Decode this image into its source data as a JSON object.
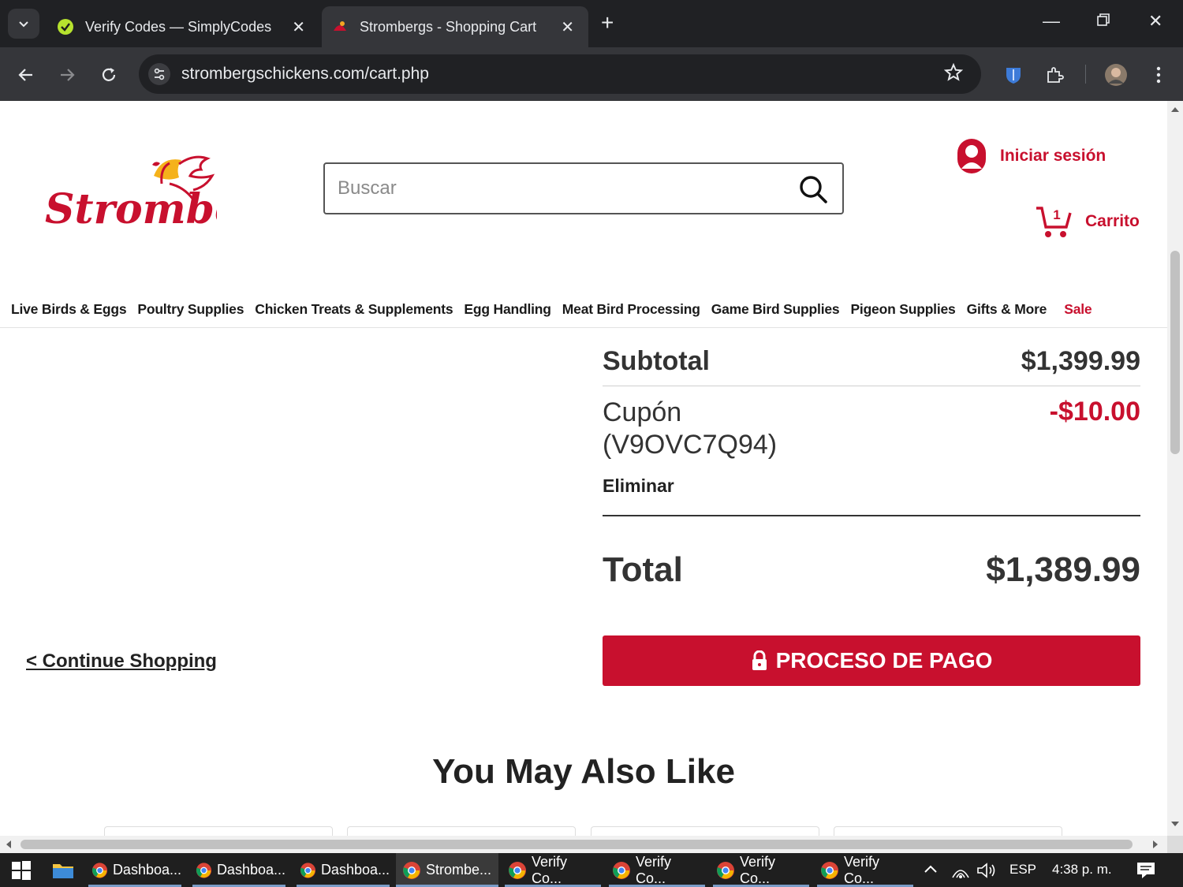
{
  "browser": {
    "tabs": [
      {
        "title": "Verify Codes — SimplyCodes"
      },
      {
        "title": "Strombergs - Shopping Cart"
      }
    ],
    "url": "strombergschickens.com/cart.php"
  },
  "header": {
    "logo_text": "Strombergs",
    "search_placeholder": "Buscar",
    "login_label": "Iniciar sesión",
    "cart_label": "Carrito",
    "cart_count": "1"
  },
  "nav": {
    "items": [
      "Live Birds & Eggs",
      "Poultry Supplies",
      "Chicken Treats & Supplements",
      "Egg Handling",
      "Meat Bird Processing",
      "Game Bird Supplies",
      "Pigeon Supplies",
      "Gifts & More"
    ],
    "sale": "Sale"
  },
  "summary": {
    "subtotal_label": "Subtotal",
    "subtotal_value": "$1,399.99",
    "coupon_label": "Cupón (V9OVC7Q94)",
    "coupon_value": "-$10.00",
    "coupon_remove": "Eliminar",
    "total_label": "Total",
    "total_value": "$1,389.99"
  },
  "actions": {
    "continue_shopping": "< Continue Shopping",
    "checkout": "PROCESO DE PAGO"
  },
  "recommend": {
    "title": "You May Also Like"
  },
  "taskbar": {
    "items": [
      "Dashboa...",
      "Dashboa...",
      "Dashboa...",
      "Strombe...",
      "Verify Co...",
      "Verify Co...",
      "Verify Co...",
      "Verify Co..."
    ],
    "lang": "ESP",
    "time": "4:38 p. m."
  },
  "colors": {
    "brand_red": "#c8102e",
    "chrome_dark": "#202124",
    "chrome_toolbar": "#35363a"
  }
}
